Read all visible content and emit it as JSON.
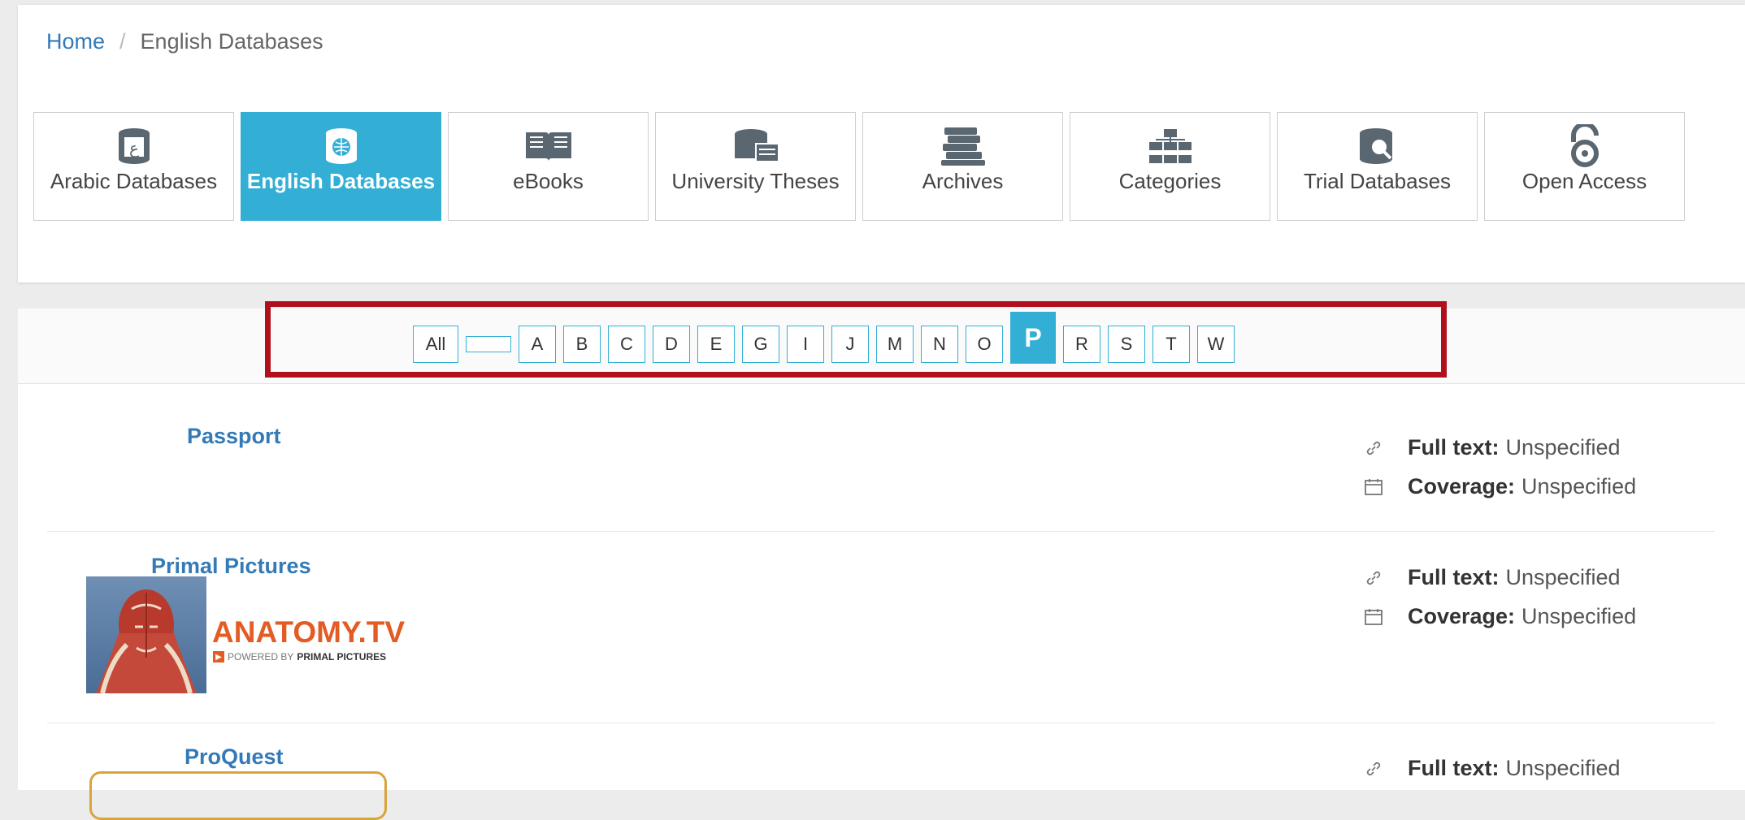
{
  "breadcrumb": {
    "home": "Home",
    "separator": "/",
    "current": "English Databases"
  },
  "tiles": [
    {
      "label": "Arabic Databases",
      "icon": "arabic-database-icon"
    },
    {
      "label": "English Databases",
      "icon": "english-database-icon",
      "active": true
    },
    {
      "label": "eBooks",
      "icon": "ebook-icon"
    },
    {
      "label": "University Theses",
      "icon": "theses-icon"
    },
    {
      "label": "Archives",
      "icon": "archives-icon"
    },
    {
      "label": "Categories",
      "icon": "categories-icon"
    },
    {
      "label": "Trial Databases",
      "icon": "trial-database-icon"
    },
    {
      "label": "Open Access",
      "icon": "open-access-icon"
    }
  ],
  "letters": [
    "All",
    "",
    "A",
    "B",
    "C",
    "D",
    "E",
    "G",
    "I",
    "J",
    "M",
    "N",
    "O",
    "P",
    "R",
    "S",
    "T",
    "W"
  ],
  "active_letter": "P",
  "records": [
    {
      "title": "Passport",
      "full_text_label": "Full text:",
      "full_text_value": "Unspecified",
      "coverage_label": "Coverage:",
      "coverage_value": "Unspecified"
    },
    {
      "title": "Primal Pictures",
      "full_text_label": "Full text:",
      "full_text_value": "Unspecified",
      "coverage_label": "Coverage:",
      "coverage_value": "Unspecified",
      "logo_text": "ANATOMY.TV",
      "logo_subtext_prefix": "POWERED BY",
      "logo_subtext_brand": "PRIMAL PICTURES"
    },
    {
      "title": "ProQuest",
      "full_text_label": "Full text:",
      "full_text_value": "Unspecified"
    }
  ],
  "colors": {
    "accent": "#33afd6",
    "link": "#337ab7",
    "highlight": "#b0101c",
    "anatomy_orange": "#e35c24"
  }
}
